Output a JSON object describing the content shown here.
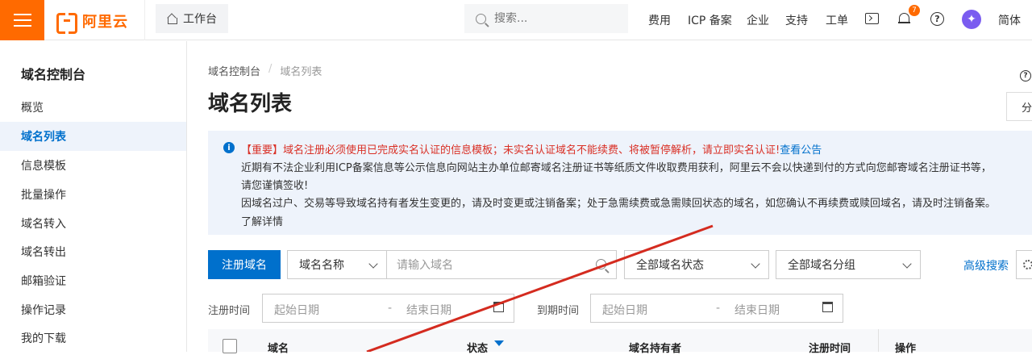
{
  "topbar": {
    "logo": "阿里云",
    "workbench": "工作台",
    "search_placeholder": "搜索...",
    "nav": [
      "费用",
      "ICP 备案",
      "企业",
      "支持",
      "工单"
    ],
    "notification_count": "7",
    "help": "?",
    "avatar": "✦",
    "lang": "简体"
  },
  "sidebar": {
    "title": "域名控制台",
    "items": [
      "概览",
      "域名列表",
      "信息模板",
      "批量操作",
      "域名转入",
      "域名转出",
      "邮箱验证",
      "操作记录",
      "我的下载"
    ],
    "active_index": 1
  },
  "breadcrumb": {
    "root": "域名控制台",
    "sep": "/",
    "current": "域名列表"
  },
  "page_title": "域名列表",
  "right_help": "?",
  "right_button": "分",
  "notice": {
    "icon": "i",
    "line1_red": "【重要】域名注册必须使用已完成实名认证的信息模板；未实名认证域名不能续费、将被暂停解析，请立即实名认证!",
    "line1_link": "查看公告",
    "line2": "近期有不法企业利用ICP备案信息等公示信息向网站主办单位邮寄域名注册证书等纸质文件收取费用获利，阿里云不会以快递到付的方式向您邮寄域名注册证书等，",
    "line3": "请您谨慎签收!",
    "line4": "因域名过户、交易等导致域名持有者发生变更的，请及时变更或注销备案；处于急需续费或急需赎回状态的域名，如您确认不再续费或赎回域名，请及时注销备案。",
    "line5_link": "了解详情"
  },
  "toolbar": {
    "register": "注册域名",
    "name_select": "域名名称",
    "domain_placeholder": "请输入域名",
    "status_select": "全部域名状态",
    "group_select": "全部域名分组",
    "advanced": "高级搜索"
  },
  "dates": {
    "reg_label": "注册时间",
    "exp_label": "到期时间",
    "start": "起始日期",
    "dash": "-",
    "end": "结束日期"
  },
  "table": {
    "headers": [
      "域名",
      "状态",
      "域名持有者",
      "注册时间",
      "操作"
    ]
  },
  "colors": {
    "accent": "#0070cc",
    "brand": "#ff6a00",
    "alert": "#d93026",
    "arrow": "#d42b1f"
  }
}
